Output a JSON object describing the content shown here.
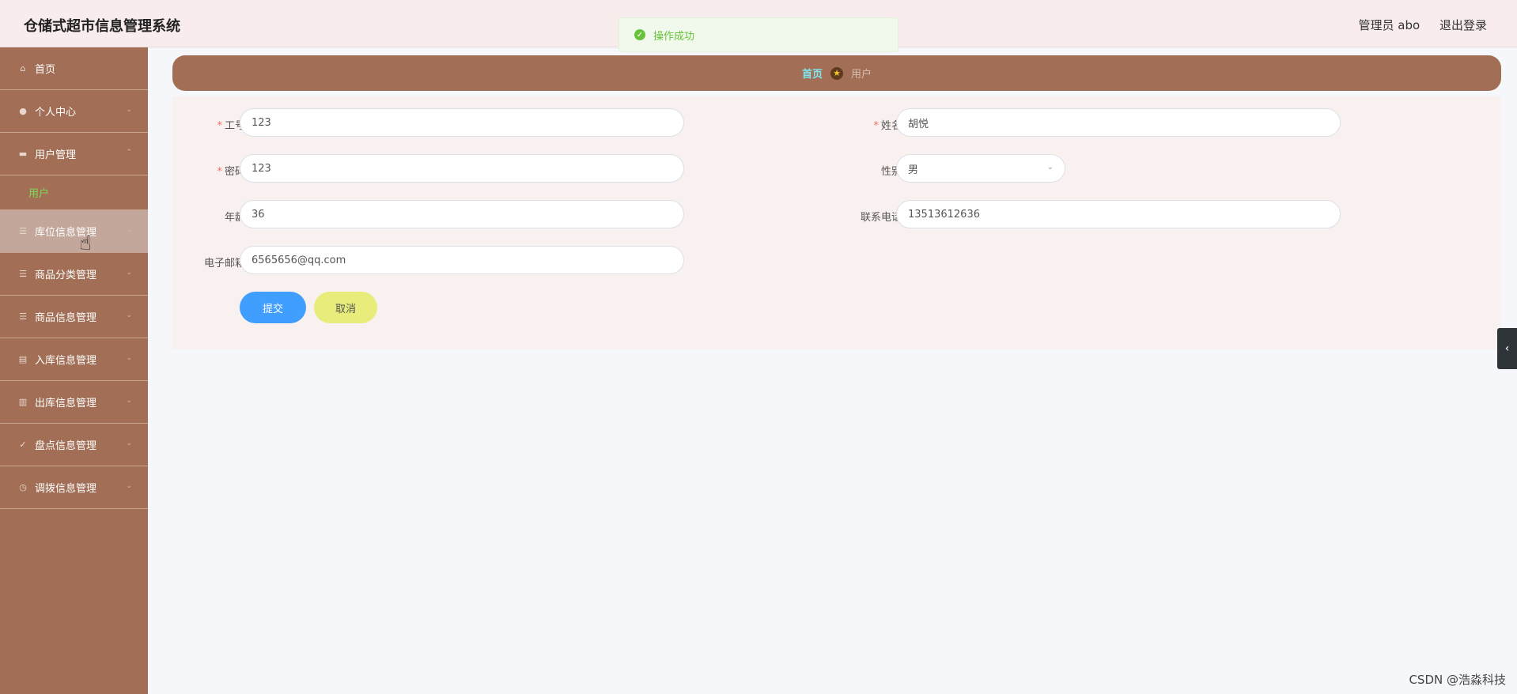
{
  "header": {
    "title": "仓储式超市信息管理系统",
    "user_label": "管理员 abo",
    "logout_label": "退出登录"
  },
  "toast": {
    "message": "操作成功",
    "color": "#67c23a"
  },
  "sidebar": {
    "bg_color": "#a26f56",
    "items": [
      {
        "label": "首页",
        "icon": "home-icon"
      },
      {
        "label": "个人中心",
        "icon": "user-icon"
      },
      {
        "label": "用户管理",
        "icon": "users-icon",
        "sub": [
          "用户"
        ]
      },
      {
        "label": "库位信息管理",
        "icon": "list-icon"
      },
      {
        "label": "商品分类管理",
        "icon": "filter-icon"
      },
      {
        "label": "商品信息管理",
        "icon": "list-icon"
      },
      {
        "label": "入库信息管理",
        "icon": "inbox-icon"
      },
      {
        "label": "出库信息管理",
        "icon": "outbox-icon"
      },
      {
        "label": "盘点信息管理",
        "icon": "check-icon"
      },
      {
        "label": "调拨信息管理",
        "icon": "clock-icon"
      }
    ]
  },
  "breadcrumb": {
    "home": "首页",
    "current": "用户"
  },
  "form": {
    "gonghao_label": "工号",
    "gonghao_value": "123",
    "xingming_label": "姓名",
    "xingming_value": "胡悦",
    "mima_label": "密码",
    "mima_value": "123",
    "xingbie_label": "性别",
    "xingbie_value": "男",
    "nianling_label": "年龄",
    "nianling_value": "36",
    "lianxidianhua_label": "联系电话",
    "lianxidianhua_value": "13513612636",
    "youxiang_label": "电子邮箱",
    "youxiang_value": "6565656@qq.com",
    "submit_label": "提交",
    "cancel_label": "取消"
  },
  "watermark": "CSDN @浩淼科技"
}
